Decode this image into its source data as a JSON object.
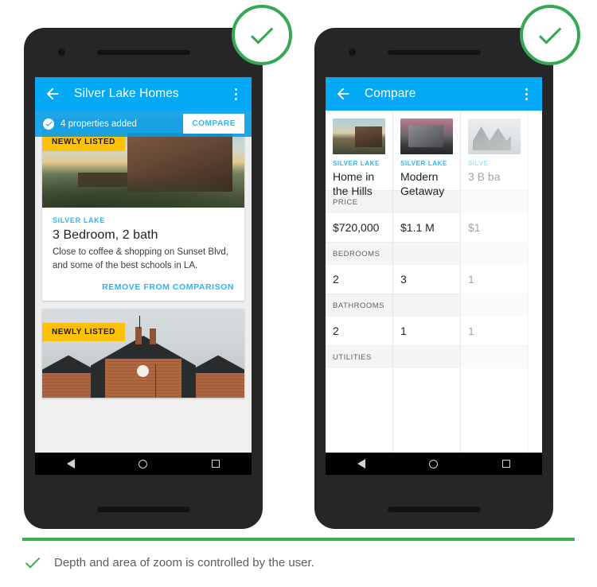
{
  "colors": {
    "toolbar_blue": "#03a9f4",
    "accent_blue": "#29b6f6",
    "badge_yellow": "#ffc107",
    "check_green": "#34a853",
    "rule_green": "#3fae4f",
    "phone_body": "#262626"
  },
  "left_phone": {
    "toolbar": {
      "back_icon": "arrow-back-icon",
      "title": "Silver Lake Homes",
      "overflow_icon": "more-vert-icon"
    },
    "snackbar": {
      "check_icon": "check-circle-icon",
      "message": "4 properties added",
      "action_label": "COMPARE"
    },
    "cards": [
      {
        "badge": "NEWLY LISTED",
        "eyebrow": "SILVER LAKE",
        "title": "3 Bedroom, 2 bath",
        "description": "Close to coffee & shopping on Sunset Blvd, and some of the best schools in LA.",
        "action_label": "REMOVE FROM COMPARISON"
      },
      {
        "badge": "NEWLY LISTED"
      }
    ],
    "navbar": {
      "back_icon": "nav-back-icon",
      "home_icon": "nav-home-icon",
      "recents_icon": "nav-recents-icon"
    }
  },
  "right_phone": {
    "toolbar": {
      "back_icon": "arrow-back-icon",
      "title": "Compare",
      "overflow_icon": "more-vert-icon"
    },
    "compare": {
      "columns": [
        {
          "eyebrow": "SILVER LAKE",
          "name": "Home in the Hills"
        },
        {
          "eyebrow": "SILVER LAKE",
          "name": "Modern Getaway"
        },
        {
          "eyebrow": "SILVE",
          "name": "3 B ba"
        }
      ],
      "rows": [
        {
          "label": "PRICE",
          "values": [
            "$720,000",
            "$1.1 M",
            "$1"
          ]
        },
        {
          "label": "BEDROOMS",
          "values": [
            "2",
            "3",
            "1"
          ]
        },
        {
          "label": "BATHROOMS",
          "values": [
            "2",
            "1",
            "1"
          ]
        },
        {
          "label": "UTILITIES",
          "values": [
            "",
            "",
            ""
          ]
        }
      ]
    },
    "navbar": {
      "back_icon": "nav-back-icon",
      "home_icon": "nav-home-icon",
      "recents_icon": "nav-recents-icon"
    }
  },
  "annotations": {
    "badge_icon": "check-circle-outline-icon",
    "caption_icon": "check-icon",
    "caption_text": "Depth and area of zoom is controlled by the user."
  }
}
